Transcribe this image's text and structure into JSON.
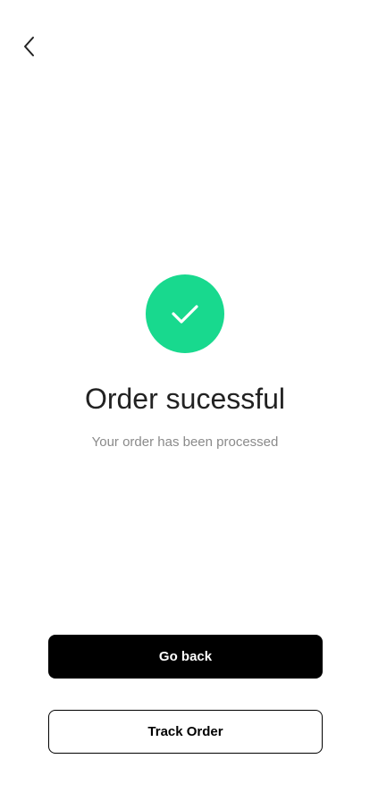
{
  "header": {
    "back_icon": "chevron-left-icon"
  },
  "success": {
    "icon": "checkmark-icon",
    "circle_color": "#18D98E",
    "title": "Order sucessful",
    "message": "Your order has been processed"
  },
  "actions": {
    "primary_label": "Go back",
    "secondary_label": "Track Order"
  },
  "colors": {
    "primary_button_bg": "#000000",
    "primary_button_text": "#FFFFFF",
    "secondary_button_border": "#000000"
  }
}
